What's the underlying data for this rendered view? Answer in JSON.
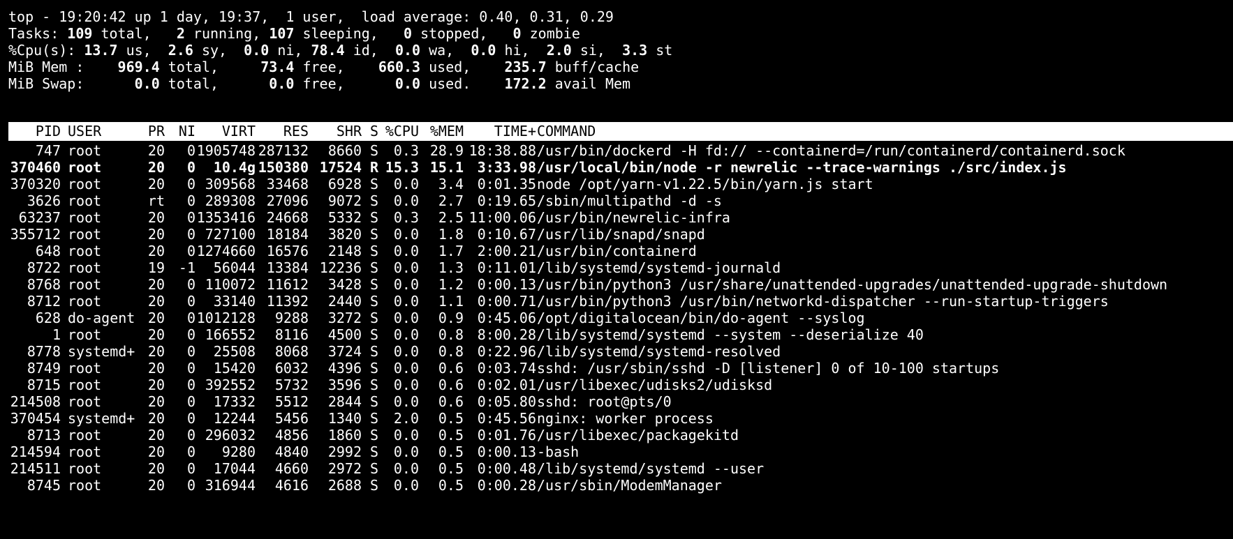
{
  "summary": {
    "line1": "top - 19:20:42 up 1 day, 19:37,  1 user,  load average: 0.40, 0.31, 0.29",
    "tasks": {
      "label": "Tasks: ",
      "total": "109",
      "total_suffix": " total,   ",
      "running": "2",
      "running_suffix": " running, ",
      "sleeping": "107",
      "sleeping_suffix": " sleeping,   ",
      "stopped": "0",
      "stopped_suffix": " stopped,   ",
      "zombie": "0",
      "zombie_suffix": " zombie"
    },
    "cpu": {
      "label": "%Cpu(s): ",
      "us": "13.7",
      "us_suffix": " us,  ",
      "sy": "2.6",
      "sy_suffix": " sy,  ",
      "ni": "0.0",
      "ni_suffix": " ni, ",
      "id": "78.4",
      "id_suffix": " id,  ",
      "wa": "0.0",
      "wa_suffix": " wa,  ",
      "hi": "0.0",
      "hi_suffix": " hi,  ",
      "si": "2.0",
      "si_suffix": " si,  ",
      "st": "3.3",
      "st_suffix": " st"
    },
    "mem": {
      "label": "MiB Mem :    ",
      "total": "969.4",
      "total_suffix": " total,     ",
      "free": "73.4",
      "free_suffix": " free,    ",
      "used": "660.3",
      "used_suffix": " used,    ",
      "buff": "235.7",
      "buff_suffix": " buff/cache"
    },
    "swap": {
      "label": "MiB Swap:      ",
      "total": "0.0",
      "total_suffix": " total,      ",
      "free": "0.0",
      "free_suffix": " free,      ",
      "used": "0.0",
      "used_suffix": " used.    ",
      "avail": "172.2",
      "avail_suffix": " avail Mem"
    }
  },
  "columns": [
    "PID",
    "USER",
    "PR",
    "NI",
    "VIRT",
    "RES",
    "SHR",
    "S",
    "%CPU",
    "%MEM",
    "TIME+",
    "COMMAND"
  ],
  "processes": [
    {
      "pid": "747",
      "user": "root",
      "pr": "20",
      "ni": "0",
      "virt": "1905748",
      "res": "287132",
      "shr": "8660",
      "s": "S",
      "cpu": "0.3",
      "mem": "28.9",
      "time": "18:38.88",
      "command": "/usr/bin/dockerd -H fd:// --containerd=/run/containerd/containerd.sock"
    },
    {
      "pid": "370460",
      "user": "root",
      "pr": "20",
      "ni": "0",
      "virt": "10.4g",
      "res": "150380",
      "shr": "17524",
      "s": "R",
      "cpu": "15.3",
      "mem": "15.1",
      "time": "3:33.98",
      "command": "/usr/local/bin/node -r newrelic --trace-warnings ./src/index.js",
      "highlight": true
    },
    {
      "pid": "370320",
      "user": "root",
      "pr": "20",
      "ni": "0",
      "virt": "309568",
      "res": "33468",
      "shr": "6928",
      "s": "S",
      "cpu": "0.0",
      "mem": "3.4",
      "time": "0:01.35",
      "command": "node /opt/yarn-v1.22.5/bin/yarn.js start"
    },
    {
      "pid": "3626",
      "user": "root",
      "pr": "rt",
      "ni": "0",
      "virt": "289308",
      "res": "27096",
      "shr": "9072",
      "s": "S",
      "cpu": "0.0",
      "mem": "2.7",
      "time": "0:19.65",
      "command": "/sbin/multipathd -d -s"
    },
    {
      "pid": "63237",
      "user": "root",
      "pr": "20",
      "ni": "0",
      "virt": "1353416",
      "res": "24668",
      "shr": "5332",
      "s": "S",
      "cpu": "0.3",
      "mem": "2.5",
      "time": "11:00.06",
      "command": "/usr/bin/newrelic-infra"
    },
    {
      "pid": "355712",
      "user": "root",
      "pr": "20",
      "ni": "0",
      "virt": "727100",
      "res": "18184",
      "shr": "3820",
      "s": "S",
      "cpu": "0.0",
      "mem": "1.8",
      "time": "0:10.67",
      "command": "/usr/lib/snapd/snapd"
    },
    {
      "pid": "648",
      "user": "root",
      "pr": "20",
      "ni": "0",
      "virt": "1274660",
      "res": "16576",
      "shr": "2148",
      "s": "S",
      "cpu": "0.0",
      "mem": "1.7",
      "time": "2:00.21",
      "command": "/usr/bin/containerd"
    },
    {
      "pid": "8722",
      "user": "root",
      "pr": "19",
      "ni": "-1",
      "virt": "56044",
      "res": "13384",
      "shr": "12236",
      "s": "S",
      "cpu": "0.0",
      "mem": "1.3",
      "time": "0:11.01",
      "command": "/lib/systemd/systemd-journald"
    },
    {
      "pid": "8768",
      "user": "root",
      "pr": "20",
      "ni": "0",
      "virt": "110072",
      "res": "11612",
      "shr": "3428",
      "s": "S",
      "cpu": "0.0",
      "mem": "1.2",
      "time": "0:00.13",
      "command": "/usr/bin/python3 /usr/share/unattended-upgrades/unattended-upgrade-shutdown"
    },
    {
      "pid": "8712",
      "user": "root",
      "pr": "20",
      "ni": "0",
      "virt": "33140",
      "res": "11392",
      "shr": "2440",
      "s": "S",
      "cpu": "0.0",
      "mem": "1.1",
      "time": "0:00.71",
      "command": "/usr/bin/python3 /usr/bin/networkd-dispatcher --run-startup-triggers"
    },
    {
      "pid": "628",
      "user": "do-agent",
      "pr": "20",
      "ni": "0",
      "virt": "1012128",
      "res": "9288",
      "shr": "3272",
      "s": "S",
      "cpu": "0.0",
      "mem": "0.9",
      "time": "0:45.06",
      "command": "/opt/digitalocean/bin/do-agent --syslog"
    },
    {
      "pid": "1",
      "user": "root",
      "pr": "20",
      "ni": "0",
      "virt": "166552",
      "res": "8116",
      "shr": "4500",
      "s": "S",
      "cpu": "0.0",
      "mem": "0.8",
      "time": "8:00.28",
      "command": "/lib/systemd/systemd --system --deserialize 40"
    },
    {
      "pid": "8778",
      "user": "systemd+",
      "pr": "20",
      "ni": "0",
      "virt": "25508",
      "res": "8068",
      "shr": "3724",
      "s": "S",
      "cpu": "0.0",
      "mem": "0.8",
      "time": "0:22.96",
      "command": "/lib/systemd/systemd-resolved"
    },
    {
      "pid": "8749",
      "user": "root",
      "pr": "20",
      "ni": "0",
      "virt": "15420",
      "res": "6032",
      "shr": "4396",
      "s": "S",
      "cpu": "0.0",
      "mem": "0.6",
      "time": "0:03.74",
      "command": "sshd: /usr/sbin/sshd -D [listener] 0 of 10-100 startups"
    },
    {
      "pid": "8715",
      "user": "root",
      "pr": "20",
      "ni": "0",
      "virt": "392552",
      "res": "5732",
      "shr": "3596",
      "s": "S",
      "cpu": "0.0",
      "mem": "0.6",
      "time": "0:02.01",
      "command": "/usr/libexec/udisks2/udisksd"
    },
    {
      "pid": "214508",
      "user": "root",
      "pr": "20",
      "ni": "0",
      "virt": "17332",
      "res": "5512",
      "shr": "2844",
      "s": "S",
      "cpu": "0.0",
      "mem": "0.6",
      "time": "0:05.80",
      "command": "sshd: root@pts/0"
    },
    {
      "pid": "370454",
      "user": "systemd+",
      "pr": "20",
      "ni": "0",
      "virt": "12244",
      "res": "5456",
      "shr": "1340",
      "s": "S",
      "cpu": "2.0",
      "mem": "0.5",
      "time": "0:45.56",
      "command": "nginx: worker process"
    },
    {
      "pid": "8713",
      "user": "root",
      "pr": "20",
      "ni": "0",
      "virt": "296032",
      "res": "4856",
      "shr": "1860",
      "s": "S",
      "cpu": "0.0",
      "mem": "0.5",
      "time": "0:01.76",
      "command": "/usr/libexec/packagekitd"
    },
    {
      "pid": "214594",
      "user": "root",
      "pr": "20",
      "ni": "0",
      "virt": "9280",
      "res": "4840",
      "shr": "2992",
      "s": "S",
      "cpu": "0.0",
      "mem": "0.5",
      "time": "0:00.13",
      "command": "-bash"
    },
    {
      "pid": "214511",
      "user": "root",
      "pr": "20",
      "ni": "0",
      "virt": "17044",
      "res": "4660",
      "shr": "2972",
      "s": "S",
      "cpu": "0.0",
      "mem": "0.5",
      "time": "0:00.48",
      "command": "/lib/systemd/systemd --user"
    },
    {
      "pid": "8745",
      "user": "root",
      "pr": "20",
      "ni": "0",
      "virt": "316944",
      "res": "4616",
      "shr": "2688",
      "s": "S",
      "cpu": "0.0",
      "mem": "0.5",
      "time": "0:00.28",
      "command": "/usr/sbin/ModemManager"
    }
  ],
  "colors": {
    "background": "#000000",
    "foreground": "#ffffff",
    "header_bg": "#ffffff",
    "header_fg": "#000000"
  }
}
